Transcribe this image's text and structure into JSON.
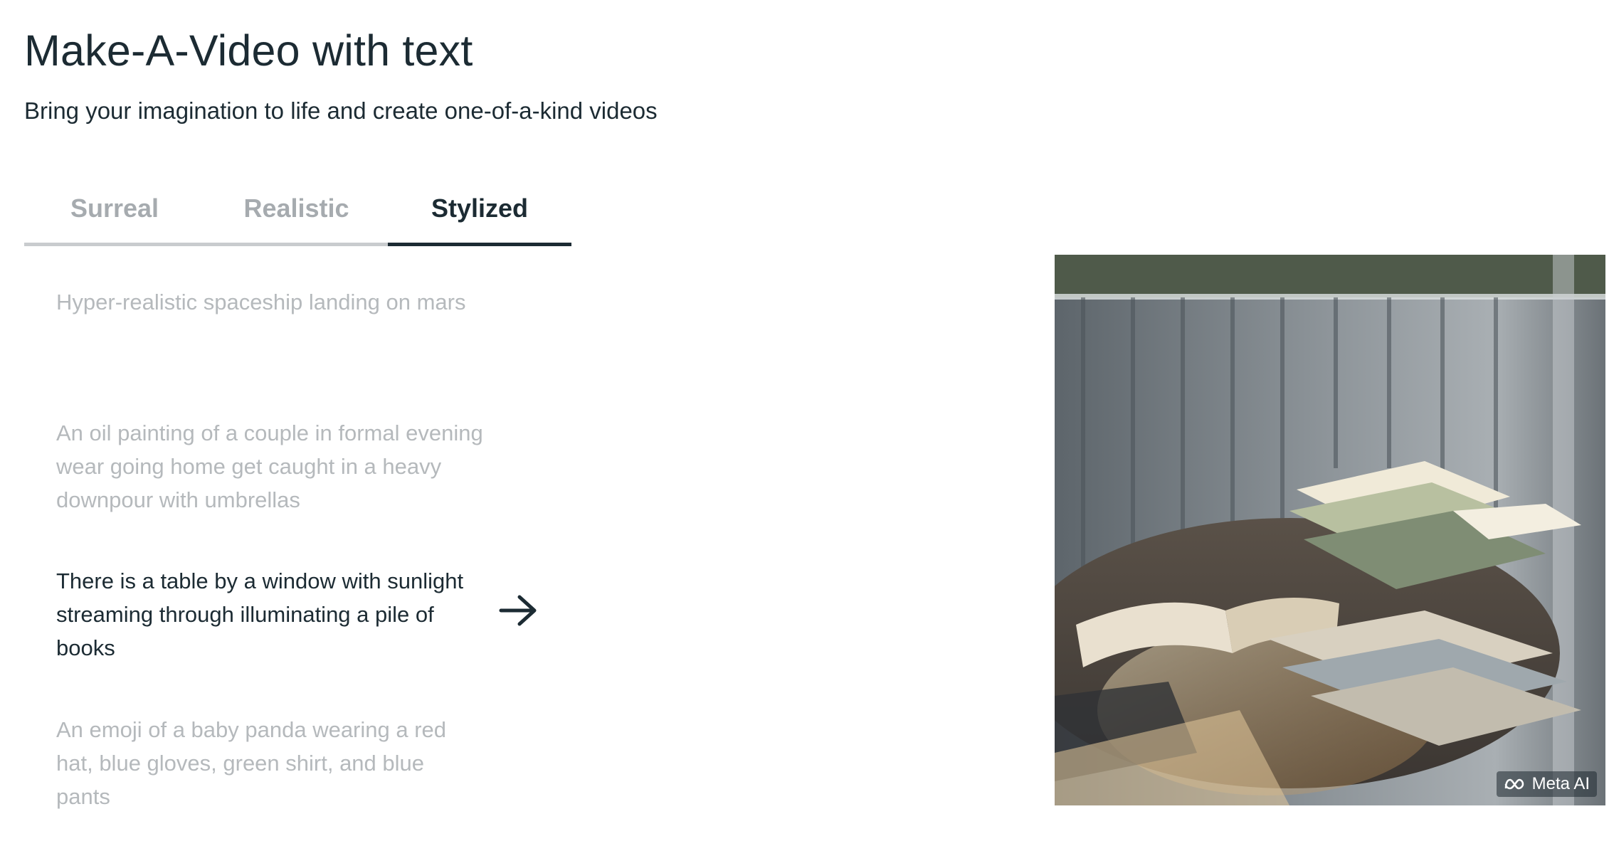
{
  "header": {
    "title": "Make-A-Video with text",
    "subtitle": "Bring your imagination to life and create one-of-a-kind videos"
  },
  "tabs": [
    {
      "label": "Surreal",
      "active": false
    },
    {
      "label": "Realistic",
      "active": false
    },
    {
      "label": "Stylized",
      "active": true
    }
  ],
  "prompts": [
    {
      "text": "Hyper-realistic spaceship landing on mars",
      "active": false
    },
    {
      "text": "An oil painting of a couple in formal evening wear going home get caught in a heavy downpour with umbrellas",
      "active": false
    },
    {
      "text": "There is a table by a window with sunlight streaming through illuminating a pile of books",
      "active": true
    },
    {
      "text": "An emoji of a baby panda wearing a red hat, blue gloves, green shirt, and blue pants",
      "active": false
    }
  ],
  "icons": {
    "prompt_arrow": "arrow-right-icon",
    "watermark_logo": "meta-logo-icon"
  },
  "video": {
    "watermark": "Meta AI"
  },
  "colors": {
    "text_primary": "#1c2b33",
    "text_muted": "#b5b9bc",
    "tab_inactive": "#a6abaf",
    "tab_border": "#c9ccce"
  }
}
